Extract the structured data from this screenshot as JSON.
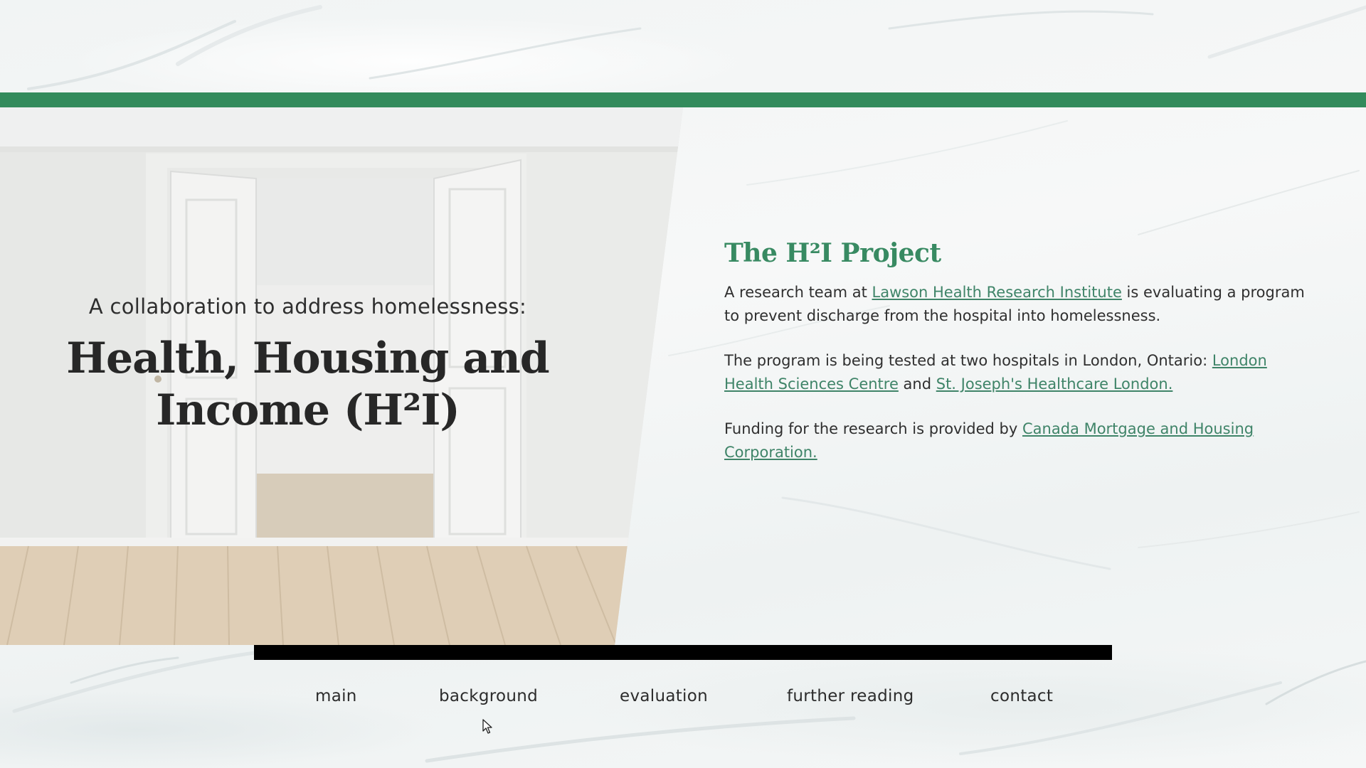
{
  "colors": {
    "accent_green": "#338b5c",
    "heading_green": "#388a62",
    "link_green": "#3f8468",
    "bar_black": "#000000"
  },
  "hero": {
    "subtitle": "A collaboration to address homelessness:",
    "title_line1": "Health, Housing and",
    "title_line2": "Income (H²I)"
  },
  "project": {
    "heading": "The H²I Project",
    "p1_prefix": "A research team at ",
    "p1_link": "Lawson Health Research Institute",
    "p1_suffix": " is evaluating a program to prevent discharge from the hospital into homelessness.",
    "p2_prefix": "The program is being tested at two hospitals in London, Ontario: ",
    "p2_link1": "London Health Sciences Centre",
    "p2_mid": " and ",
    "p2_link2": "St. Joseph's Healthcare London.",
    "p3_prefix": "Funding for the research is provided by ",
    "p3_link": "Canada Mortgage and Housing Corporation."
  },
  "nav": {
    "main": "main",
    "background": "background",
    "evaluation": "evaluation",
    "further_reading": "further reading",
    "contact": "contact"
  },
  "icons": {
    "cursor": "mouse-pointer-icon"
  }
}
